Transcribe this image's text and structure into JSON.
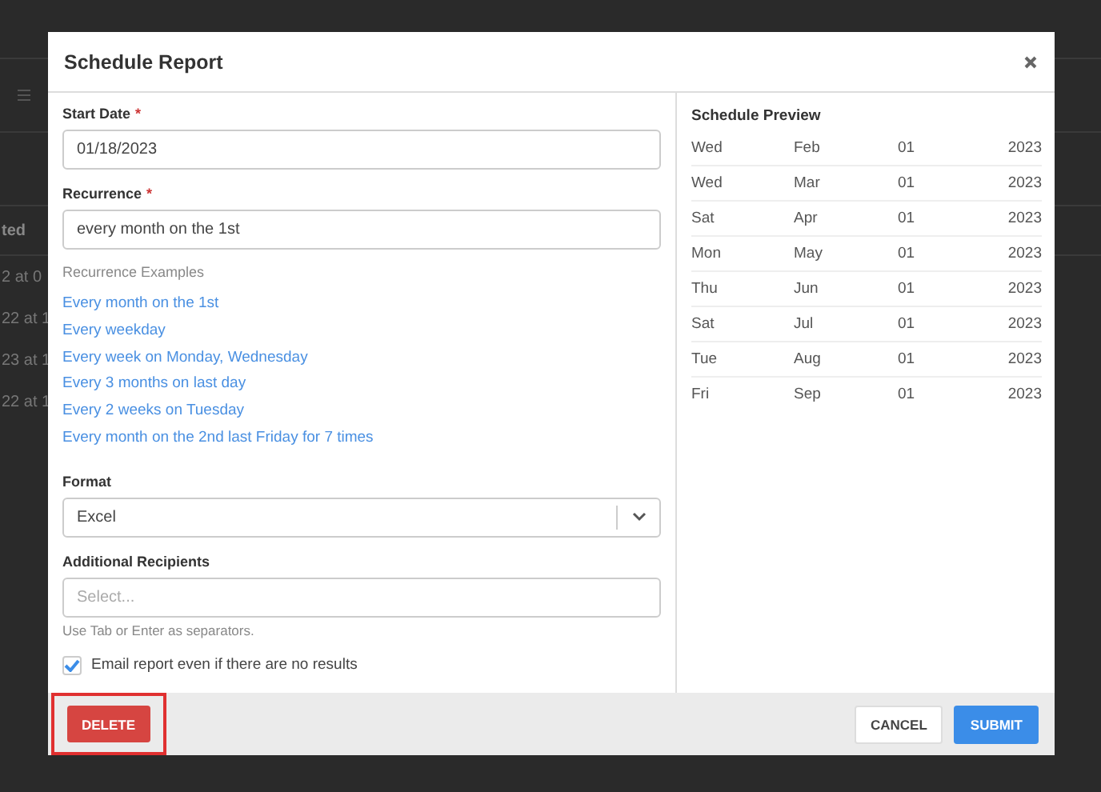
{
  "background_table": {
    "header": "ted",
    "cells": [
      "2 at 0",
      "22 at 1",
      "23 at 1",
      "22 at 1"
    ]
  },
  "dialog": {
    "title": "Schedule Report",
    "start_date": {
      "label": "Start Date",
      "required_marker": "*",
      "value": "01/18/2023"
    },
    "recurrence": {
      "label": "Recurrence",
      "required_marker": "*",
      "value": "every month on the 1st"
    },
    "examples_title": "Recurrence Examples",
    "examples": [
      "Every month on the 1st",
      "Every weekday",
      "Every week on Monday, Wednesday",
      "Every 3 months on last day",
      "Every 2 weeks on Tuesday",
      "Every month on the 2nd last Friday for 7 times"
    ],
    "format": {
      "label": "Format",
      "value": "Excel"
    },
    "recipients": {
      "label": "Additional Recipients",
      "placeholder": "Select...",
      "hint": "Use Tab or Enter as separators."
    },
    "email_empty": {
      "label": "Email report even if there are no results",
      "checked": true
    },
    "preview": {
      "title": "Schedule Preview",
      "rows": [
        [
          "Wed",
          "Feb",
          "01",
          "2023"
        ],
        [
          "Wed",
          "Mar",
          "01",
          "2023"
        ],
        [
          "Sat",
          "Apr",
          "01",
          "2023"
        ],
        [
          "Mon",
          "May",
          "01",
          "2023"
        ],
        [
          "Thu",
          "Jun",
          "01",
          "2023"
        ],
        [
          "Sat",
          "Jul",
          "01",
          "2023"
        ],
        [
          "Tue",
          "Aug",
          "01",
          "2023"
        ],
        [
          "Fri",
          "Sep",
          "01",
          "2023"
        ]
      ]
    },
    "delete": {
      "label": "DELETE",
      "highlighted": true
    },
    "cancel": "CANCEL",
    "submit": "SUBMIT"
  }
}
